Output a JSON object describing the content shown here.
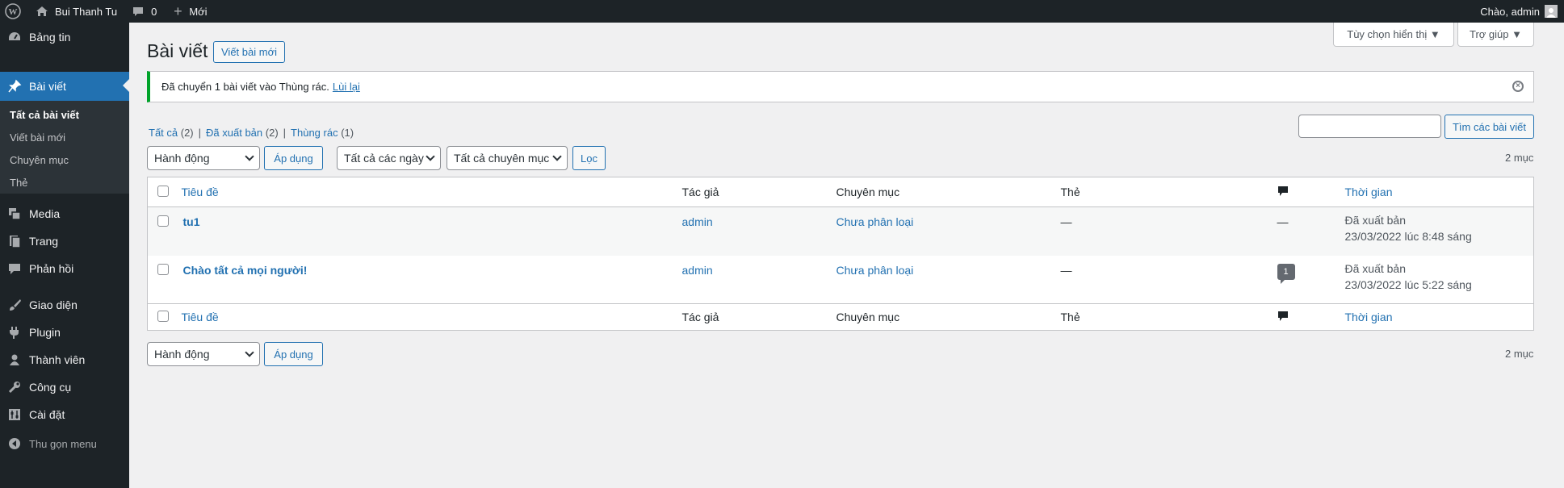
{
  "adminbar": {
    "site_name": "Bui Thanh Tu",
    "comments_count": "0",
    "new_label": "Mới",
    "greeting": "Chào, admin"
  },
  "sidebar": {
    "items": [
      {
        "label": "Bảng tin",
        "icon": "dashboard-icon"
      },
      {
        "label": "Bài viết",
        "icon": "pin-icon"
      },
      {
        "label": "Media",
        "icon": "media-icon"
      },
      {
        "label": "Trang",
        "icon": "pages-icon"
      },
      {
        "label": "Phản hồi",
        "icon": "comments-icon"
      },
      {
        "label": "Giao diện",
        "icon": "brush-icon"
      },
      {
        "label": "Plugin",
        "icon": "plugin-icon"
      },
      {
        "label": "Thành viên",
        "icon": "user-icon"
      },
      {
        "label": "Công cụ",
        "icon": "wrench-icon"
      },
      {
        "label": "Cài đặt",
        "icon": "settings-icon"
      }
    ],
    "submenu": [
      "Tất cả bài viết",
      "Viết bài mới",
      "Chuyên mục",
      "Thẻ"
    ],
    "collapse_label": "Thu gọn menu"
  },
  "header": {
    "title": "Bài viết",
    "add_new": "Viết bài mới",
    "screen_options": "Tùy chọn hiển thị ▼",
    "help": "Trợ giúp ▼"
  },
  "notice": {
    "text": "Đã chuyển 1 bài viết vào Thùng rác.",
    "undo": "Lùi lại"
  },
  "filters": {
    "all": "Tất cả",
    "all_count": "(2)",
    "published": "Đã xuất bản",
    "published_count": "(2)",
    "trash": "Thùng rác",
    "trash_count": "(1)",
    "search_button": "Tìm các bài viết",
    "bulk_action": "Hành động",
    "apply": "Áp dụng",
    "dates": "Tất cả các ngày",
    "categories": "Tất cả chuyên mục",
    "filter_button": "Lọc",
    "items_count": "2 mục"
  },
  "table": {
    "columns": {
      "title": "Tiêu đề",
      "author": "Tác giả",
      "categories": "Chuyên mục",
      "tags": "Thẻ",
      "date": "Thời gian"
    },
    "rows": [
      {
        "title": "tu1",
        "author": "admin",
        "category": "Chưa phân loại",
        "tags": "—",
        "comments": "—",
        "status": "Đã xuất bản",
        "date": "23/03/2022 lúc 8:48 sáng"
      },
      {
        "title": "Chào tất cả mọi người!",
        "author": "admin",
        "category": "Chưa phân loại",
        "tags": "—",
        "comments": "1",
        "status": "Đã xuất bản",
        "date": "23/03/2022 lúc 5:22 sáng"
      }
    ]
  },
  "colors": {
    "admin_bar": "#1d2327",
    "accent": "#2271b1",
    "notice_success": "#00a32a",
    "background": "#f0f0f1"
  }
}
